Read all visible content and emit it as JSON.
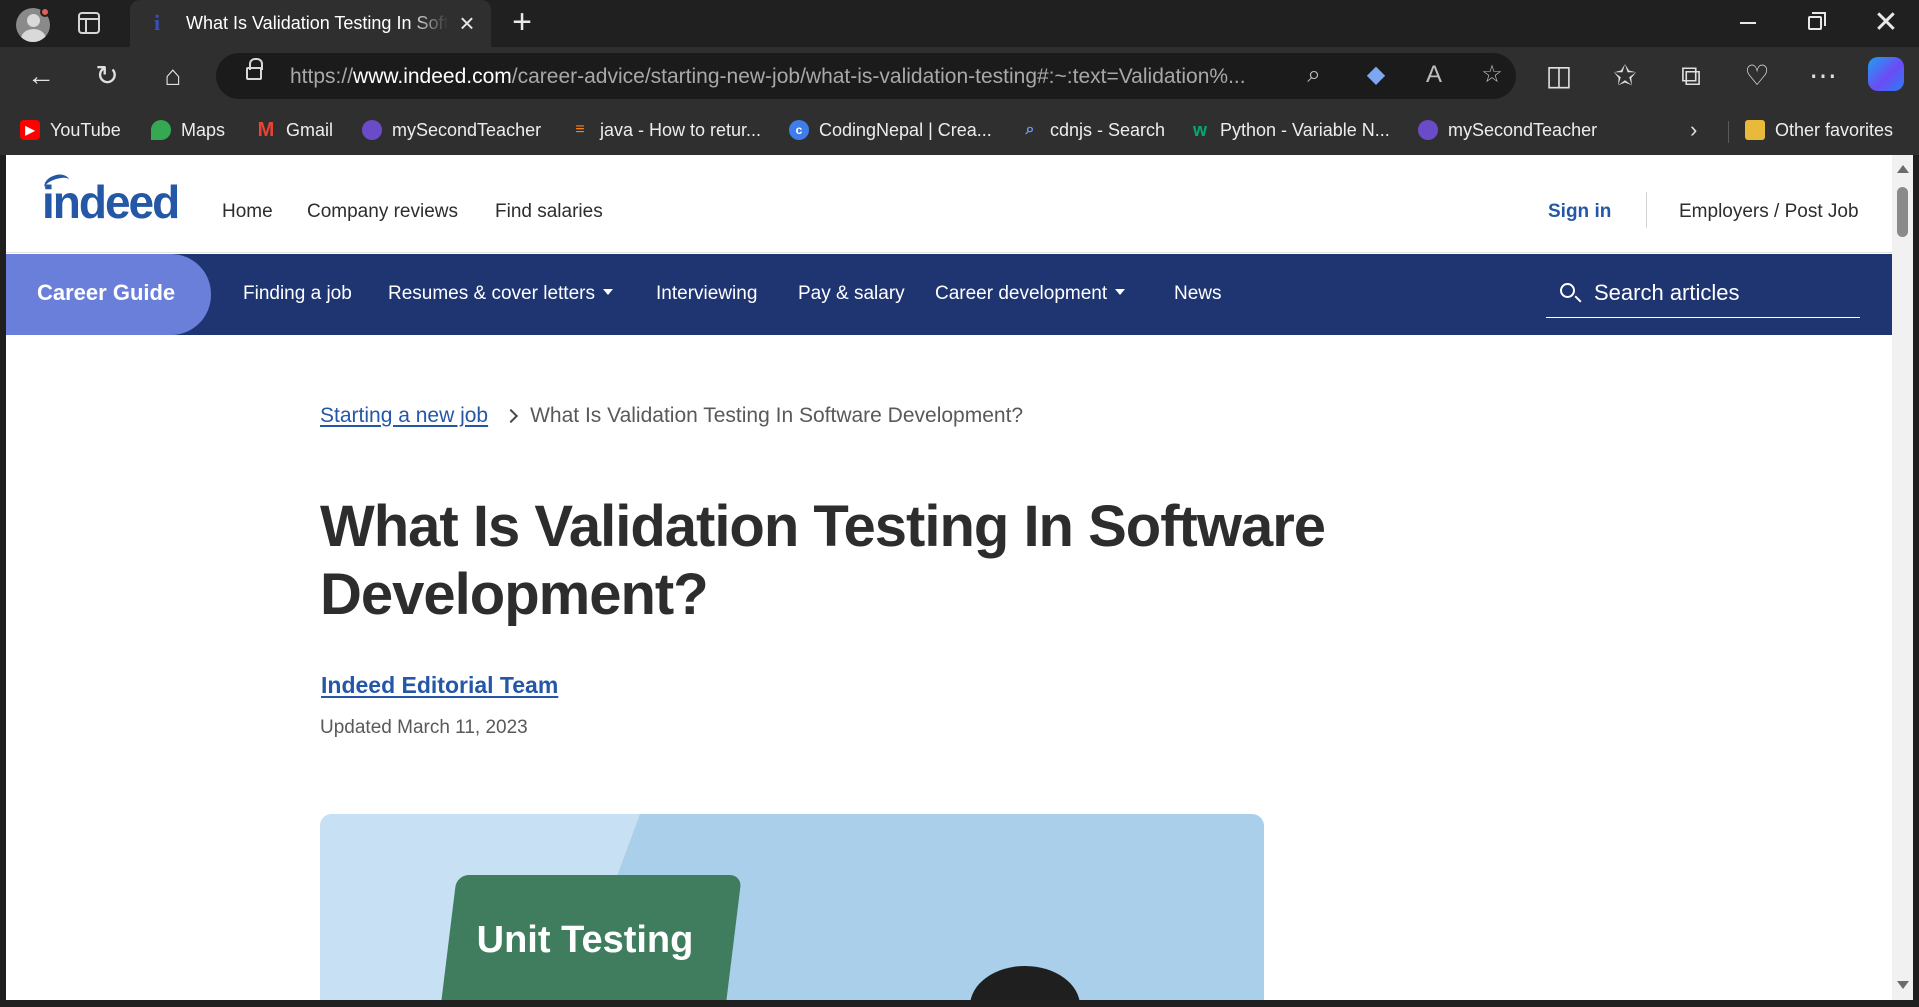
{
  "browser": {
    "tab": {
      "title": "What Is Validation Testing In Software Development? | Indeed.com",
      "favicon": "indeed-i"
    },
    "url": {
      "prefix": "https://",
      "domain": "www.indeed.com",
      "path": "/career-advice/starting-new-job/what-is-validation-testing#:~:text=Validation%..."
    },
    "bookmarks": [
      {
        "label": "YouTube",
        "icon": "youtube-icon",
        "color": "#ff0000"
      },
      {
        "label": "Maps",
        "icon": "maps-icon",
        "color": "#34a853"
      },
      {
        "label": "Gmail",
        "icon": "gmail-icon",
        "color": "#ea4335"
      },
      {
        "label": "mySecondTeacher",
        "icon": "mysecondteacher-icon",
        "color": "#6b4cc8"
      },
      {
        "label": "java - How to retur...",
        "icon": "stackoverflow-icon",
        "color": "#f48024"
      },
      {
        "label": "CodingNepal | Crea...",
        "icon": "codingnepal-icon",
        "color": "#3f7ee8"
      },
      {
        "label": "cdnjs - Search",
        "icon": "search-icon",
        "color": "#4a7bd8"
      },
      {
        "label": "Python - Variable N...",
        "icon": "w3schools-icon",
        "color": "#04aa6d"
      },
      {
        "label": "mySecondTeacher",
        "icon": "mysecondteacher-icon",
        "color": "#6b4cc8"
      }
    ],
    "other_favorites": "Other favorites"
  },
  "site": {
    "logo": "indeed",
    "nav": {
      "home": "Home",
      "reviews": "Company reviews",
      "salaries": "Find salaries"
    },
    "sign_in": "Sign in",
    "employers": "Employers / Post Job",
    "colors": {
      "brand": "#2557a7",
      "guidebar": "#1f3572",
      "pill": "#6a7fd9"
    }
  },
  "guide": {
    "label": "Career Guide",
    "nav": {
      "finding": "Finding a job",
      "resumes": "Resumes & cover letters",
      "interviewing": "Interviewing",
      "pay": "Pay & salary",
      "career": "Career development",
      "news": "News"
    },
    "search_placeholder": "Search articles"
  },
  "article": {
    "breadcrumb": {
      "parent": "Starting a new job",
      "current": "What Is Validation Testing In Software Development?"
    },
    "title": "What Is Validation Testing In Software Development?",
    "author": "Indeed Editorial Team",
    "updated": "Updated March 11, 2023",
    "hero_card_text": "Unit Testing"
  }
}
